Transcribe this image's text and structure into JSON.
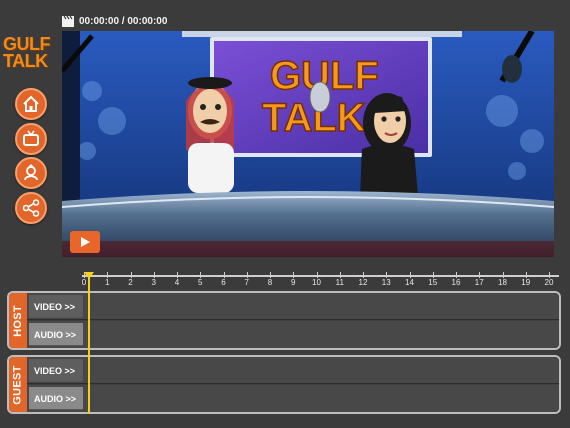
{
  "header": {
    "timecode": "00:00:00 / 00:00:00"
  },
  "logo": {
    "line1": "GULF",
    "line2": "TALK"
  },
  "sidebar": {
    "items": [
      {
        "name": "home",
        "icon": "home-icon"
      },
      {
        "name": "tv",
        "icon": "tv-icon"
      },
      {
        "name": "character",
        "icon": "character-icon"
      },
      {
        "name": "share",
        "icon": "share-icon"
      }
    ]
  },
  "scene": {
    "sign_line1": "GULF",
    "sign_line2": "TALK"
  },
  "ruler": {
    "labels": [
      "0",
      "1",
      "2",
      "3",
      "4",
      "5",
      "6",
      "7",
      "8",
      "9",
      "10",
      "11",
      "12",
      "13",
      "14",
      "15",
      "16",
      "17",
      "18",
      "19",
      "20"
    ]
  },
  "tracks": [
    {
      "label": "HOST",
      "video_label": "VIDEO >>",
      "audio_label": "AUDIO >>"
    },
    {
      "label": "GUEST",
      "video_label": "VIDEO >>",
      "audio_label": "AUDIO >>"
    }
  ],
  "colors": {
    "accent": "#e2652a",
    "playhead": "#f3d11b",
    "background": "#3b3b3b"
  }
}
